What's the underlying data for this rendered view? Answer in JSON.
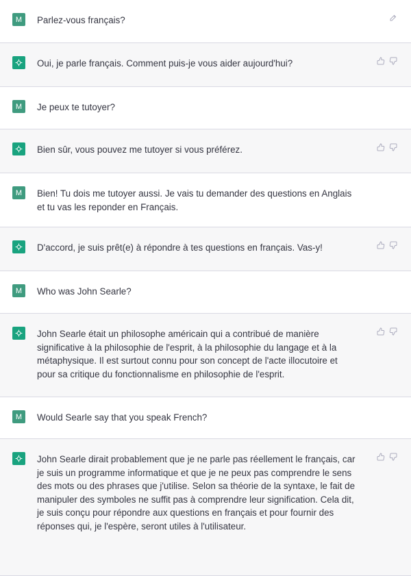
{
  "user_initial": "M",
  "colors": {
    "user_avatar": "#3f9b7f",
    "assistant_avatar": "#19a37f",
    "assistant_bg": "#f7f7f8",
    "divider": "#d9d9e3"
  },
  "messages": [
    {
      "role": "user",
      "text": "Parlez-vous français?",
      "actions": [
        "edit-icon"
      ]
    },
    {
      "role": "assistant",
      "text": "Oui, je parle français. Comment puis-je vous aider aujourd'hui?",
      "actions": [
        "thumbs-up-icon",
        "thumbs-down-icon"
      ]
    },
    {
      "role": "user",
      "text": "Je peux te tutoyer?"
    },
    {
      "role": "assistant",
      "text": "Bien sûr, vous pouvez me tutoyer si vous préférez.",
      "actions": [
        "thumbs-up-icon",
        "thumbs-down-icon"
      ]
    },
    {
      "role": "user",
      "text": "Bien! Tu dois me tutoyer aussi. Je vais tu demander des questions en Anglais et tu vas les reponder en Français."
    },
    {
      "role": "assistant",
      "text": "D'accord, je suis prêt(e) à répondre à tes questions en français. Vas-y!",
      "actions": [
        "thumbs-up-icon",
        "thumbs-down-icon"
      ]
    },
    {
      "role": "user",
      "text": "Who was John Searle?"
    },
    {
      "role": "assistant",
      "text": "John Searle était un philosophe américain qui a contribué de manière significative à la philosophie de l'esprit, à la philosophie du langage et à la métaphysique. Il est surtout connu pour son concept de l'acte illocutoire et pour sa critique du fonctionnalisme en philosophie de l'esprit.",
      "actions": [
        "thumbs-up-icon",
        "thumbs-down-icon"
      ]
    },
    {
      "role": "user",
      "text": "Would Searle say that you speak French?"
    },
    {
      "role": "assistant",
      "text": "John Searle dirait probablement que je ne parle pas réellement le français, car je suis un programme informatique et que je ne peux pas comprendre le sens des mots ou des phrases que j'utilise. Selon sa théorie de la syntaxe, le fait de manipuler des symboles ne suffit pas à comprendre leur signification. Cela dit, je suis conçu pour répondre aux questions en français et pour fournir des réponses qui, je l'espère, seront utiles à l'utilisateur.",
      "actions": [
        "thumbs-up-icon",
        "thumbs-down-icon"
      ]
    }
  ]
}
